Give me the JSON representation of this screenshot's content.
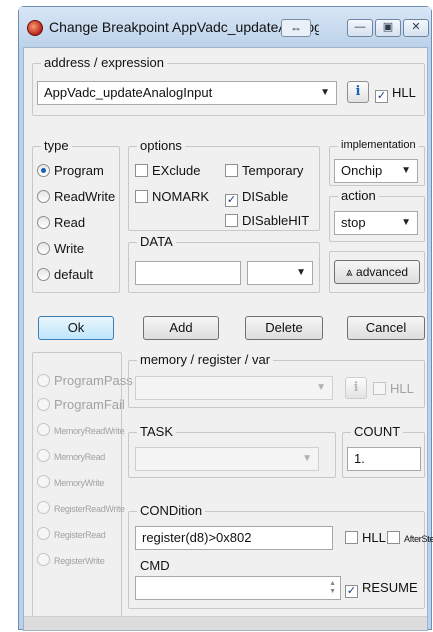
{
  "window": {
    "title": "Change Breakpoint  AppVadc_updateAnalogInp...",
    "icons": {
      "app": "bug-icon",
      "swap": "swap-arrows-icon",
      "minimize": "minimize-icon",
      "maximize": "maximize-icon",
      "close": "close-icon"
    },
    "glyphs": {
      "swap": "⇔",
      "minimize": "—",
      "maximize": "▣",
      "close": "✕"
    }
  },
  "address": {
    "legend": "address / expression",
    "value": "AppVadc_updateAnalogInput",
    "hll_label": "HLL",
    "hll_checked": true,
    "info_glyph": "i"
  },
  "type": {
    "legend": "type",
    "options": [
      "Program",
      "ReadWrite",
      "Read",
      "Write",
      "default"
    ],
    "selected": "Program"
  },
  "options": {
    "legend": "options",
    "exclude": "EXclude",
    "temporary": "Temporary",
    "nomark": "NOMARK",
    "disable": "DISable",
    "disable_checked": true,
    "disablehit": "DISableHIT"
  },
  "data": {
    "legend": "DATA",
    "value": "",
    "combo_value": ""
  },
  "implementation": {
    "legend": "implementation",
    "value": "Onchip"
  },
  "action": {
    "legend": "action",
    "value": "stop"
  },
  "advanced_label": "advanced",
  "advanced_glyph": "⩓",
  "buttons": {
    "ok": "Ok",
    "add": "Add",
    "delete": "Delete",
    "cancel": "Cancel"
  },
  "left_disabled": {
    "large": [
      "ProgramPass",
      "ProgramFail"
    ],
    "small": [
      "MemoryReadWrite",
      "MemoryRead",
      "MemoryWrite",
      "RegisterReadWrite",
      "RegisterRead",
      "RegisterWrite"
    ]
  },
  "memory": {
    "legend": "memory / register / var",
    "value": "",
    "hll_label": "HLL"
  },
  "task": {
    "legend": "TASK",
    "value": ""
  },
  "count": {
    "legend": "COUNT",
    "value": "1."
  },
  "condition": {
    "legend": "CONDition",
    "value": "register(d8)>0x802",
    "hll_label": "HLL",
    "afterstep_label": "AfterStep"
  },
  "cmd": {
    "legend": "CMD",
    "value": "",
    "resume_label": "RESUME",
    "resume_checked": true
  },
  "check_glyph": "✓"
}
